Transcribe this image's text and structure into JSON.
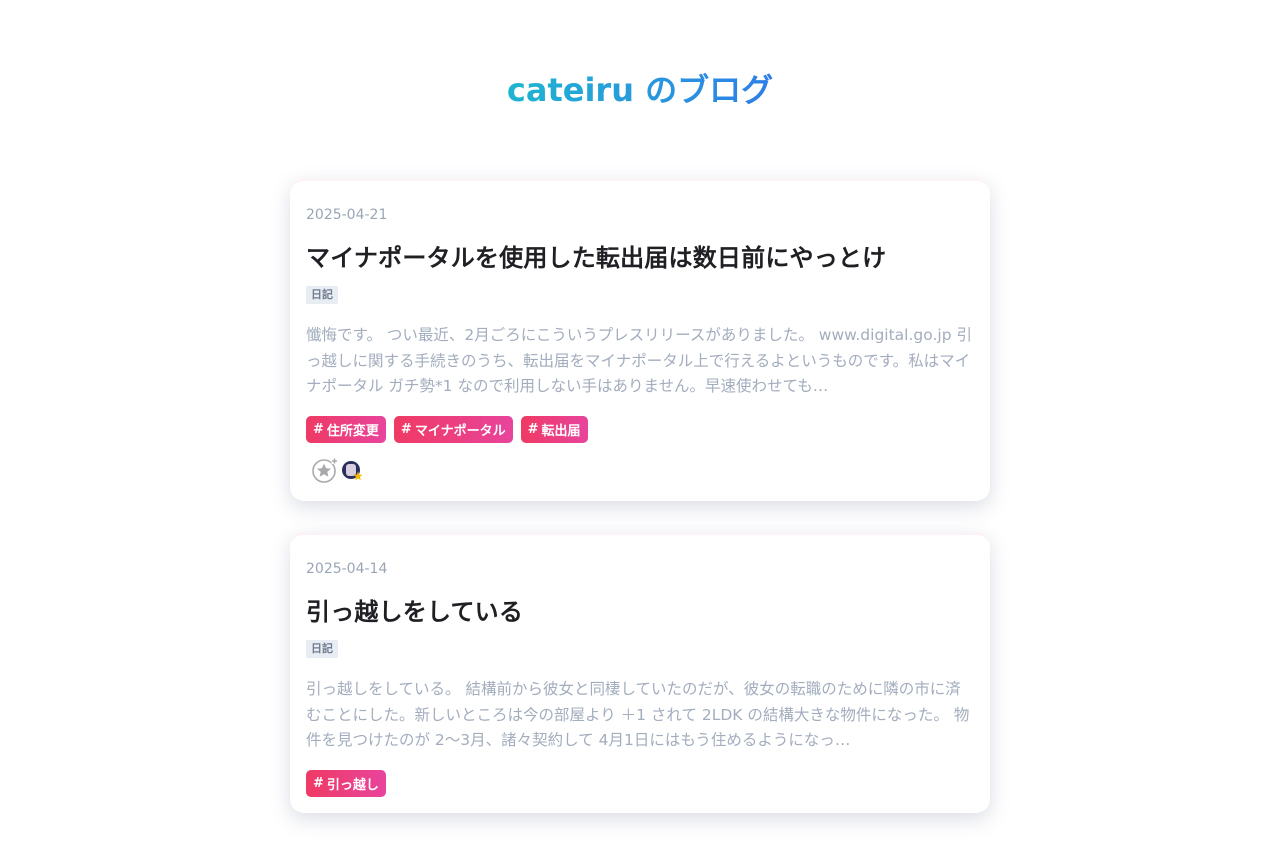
{
  "site": {
    "title": "cateiru のブログ"
  },
  "posts": [
    {
      "date": "2025-04-21",
      "title": "マイナポータルを使用した転出届は数日前にやっとけ",
      "category": "日記",
      "excerpt": "懺悔です。 つい最近、2月ごろにこういうプレスリリースがありました。 www.digital.go.jp 引っ越しに関する手続きのうち、転出届をマイナポータル上で行えるよというものです。私はマイナポータル ガチ勢*1 なので利用しない手はありません。早速使わせても…",
      "tags": [
        "住所変更",
        "マイナポータル",
        "転出届"
      ],
      "tag_prefix": "#"
    },
    {
      "date": "2025-04-14",
      "title": "引っ越しをしている",
      "category": "日記",
      "excerpt": "引っ越しをしている。 結構前から彼女と同棲していたのだが、彼女の転職のために隣の市に済むことにした。新しいところは今の部屋より ＋1 されて 2LDK の結構大きな物件になった。 物件を見つけたのが 2〜3月、諸々契約して 4月1日にはもう住めるようになっ…",
      "tags": [
        "引っ越し"
      ],
      "tag_prefix": "#"
    }
  ],
  "reactions": {
    "add_star_icon": "star-plus-icon",
    "avatar_icon": "user-avatar"
  },
  "colors": {
    "title_gradient_start": "#1fb5d0",
    "title_gradient_end": "#2f7ee8",
    "tag_gradient_start": "#ef3a64",
    "tag_gradient_end": "#e8449c",
    "category_bg": "#e8edf3",
    "excerpt_text": "#a3adbd",
    "date_text": "#9aa6b6"
  }
}
